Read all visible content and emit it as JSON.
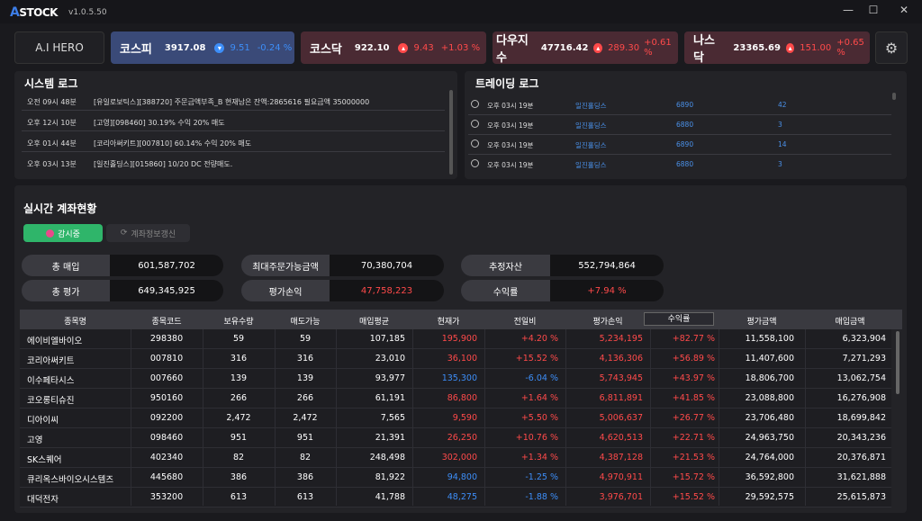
{
  "app": {
    "logo": "STOCK",
    "logo_prefix": "Ai",
    "version": "v1.0.5.50"
  },
  "header": {
    "hero_label": "A.I HERO",
    "indices": [
      {
        "name": "코스피",
        "value": "3917.08",
        "change": "9.51",
        "pct": "-0.24 %",
        "dir": "down"
      },
      {
        "name": "코스닥",
        "value": "922.10",
        "change": "9.43",
        "pct": "+1.03 %",
        "dir": "up"
      },
      {
        "name": "다우지수",
        "value": "47716.42",
        "change": "289.30",
        "pct": "+0.61 %",
        "dir": "up"
      },
      {
        "name": "나스닥",
        "value": "23365.69",
        "change": "151.00",
        "pct": "+0.65 %",
        "dir": "up"
      }
    ]
  },
  "system_log": {
    "title": "시스템 로그",
    "rows": [
      {
        "time": "오전 09시 48분",
        "msg": "[유일로보틱스][388720] 주문금액부족_B 현재남은 잔액:2865616 필요금액 35000000"
      },
      {
        "time": "오후 12시 10분",
        "msg": "[고영][098460] 30.19% 수익 20% 매도"
      },
      {
        "time": "오후 01시 44분",
        "msg": "[코리아써키트][007810] 60.14% 수익 20% 매도"
      },
      {
        "time": "오후 03시 13분",
        "msg": "[일진홀딩스][015860] 10/20 DC 전량매도."
      }
    ]
  },
  "trading_log": {
    "title": "트레이딩 로그",
    "rows": [
      {
        "time": "오후 03시 19분",
        "name": "일진홀딩스",
        "price": "6890",
        "qty": "42"
      },
      {
        "time": "오후 03시 19분",
        "name": "일진홀딩스",
        "price": "6880",
        "qty": "3"
      },
      {
        "time": "오후 03시 19분",
        "name": "일진홀딩스",
        "price": "6890",
        "qty": "14"
      },
      {
        "time": "오후 03시 19분",
        "name": "일진홀딩스",
        "price": "6880",
        "qty": "3"
      }
    ]
  },
  "account": {
    "title": "실시간 계좌현황",
    "monitor_btn": "감시중",
    "refresh_btn": "계좌정보갱신",
    "summary": [
      {
        "label": "총 매입",
        "value": "601,587,702",
        "color": "white"
      },
      {
        "label": "최대주문가능금액",
        "value": "70,380,704",
        "color": "white"
      },
      {
        "label": "추정자산",
        "value": "552,794,864",
        "color": "white"
      },
      {
        "label": "총 평가",
        "value": "649,345,925",
        "color": "white"
      },
      {
        "label": "평가손익",
        "value": "47,758,223",
        "color": "red"
      },
      {
        "label": "수익률",
        "value": "+7.94 %",
        "color": "red"
      }
    ],
    "columns": [
      "종목명",
      "종목코드",
      "보유수량",
      "매도가능",
      "매입평균",
      "현재가",
      "전일비",
      "평가손익",
      "수익률",
      "평가금액",
      "매입금액"
    ],
    "rows": [
      [
        "에이비엘바이오",
        "298380",
        "59",
        "59",
        "107,185",
        "195,900",
        "+4.20 %",
        "5,234,195",
        "+82.77 %",
        "11,558,100",
        "6,323,904"
      ],
      [
        "코리아써키트",
        "007810",
        "316",
        "316",
        "23,010",
        "36,100",
        "+15.52 %",
        "4,136,306",
        "+56.89 %",
        "11,407,600",
        "7,271,293"
      ],
      [
        "이수페타시스",
        "007660",
        "139",
        "139",
        "93,977",
        "135,300",
        "-6.04 %",
        "5,743,945",
        "+43.97 %",
        "18,806,700",
        "13,062,754"
      ],
      [
        "코오롱티슈진",
        "950160",
        "266",
        "266",
        "61,191",
        "86,800",
        "+1.64 %",
        "6,811,891",
        "+41.85 %",
        "23,088,800",
        "16,276,908"
      ],
      [
        "디아이씨",
        "092200",
        "2,472",
        "2,472",
        "7,565",
        "9,590",
        "+5.50 %",
        "5,006,637",
        "+26.77 %",
        "23,706,480",
        "18,699,842"
      ],
      [
        "고영",
        "098460",
        "951",
        "951",
        "21,391",
        "26,250",
        "+10.76 %",
        "4,620,513",
        "+22.71 %",
        "24,963,750",
        "20,343,236"
      ],
      [
        "SK스퀘어",
        "402340",
        "82",
        "82",
        "248,498",
        "302,000",
        "+1.34 %",
        "4,387,128",
        "+21.53 %",
        "24,764,000",
        "20,376,871"
      ],
      [
        "큐리옥스바이오시스템즈",
        "445680",
        "386",
        "386",
        "81,922",
        "94,800",
        "-1.25 %",
        "4,970,911",
        "+15.72 %",
        "36,592,800",
        "31,621,888"
      ],
      [
        "대덕전자",
        "353200",
        "613",
        "613",
        "41,788",
        "48,275",
        "-1.88 %",
        "3,976,701",
        "+15.52 %",
        "29,592,575",
        "25,615,873"
      ]
    ]
  },
  "colors": {
    "up": "#ff4a4a",
    "down": "#3d8ef8",
    "accent_green": "#2fb56a"
  }
}
